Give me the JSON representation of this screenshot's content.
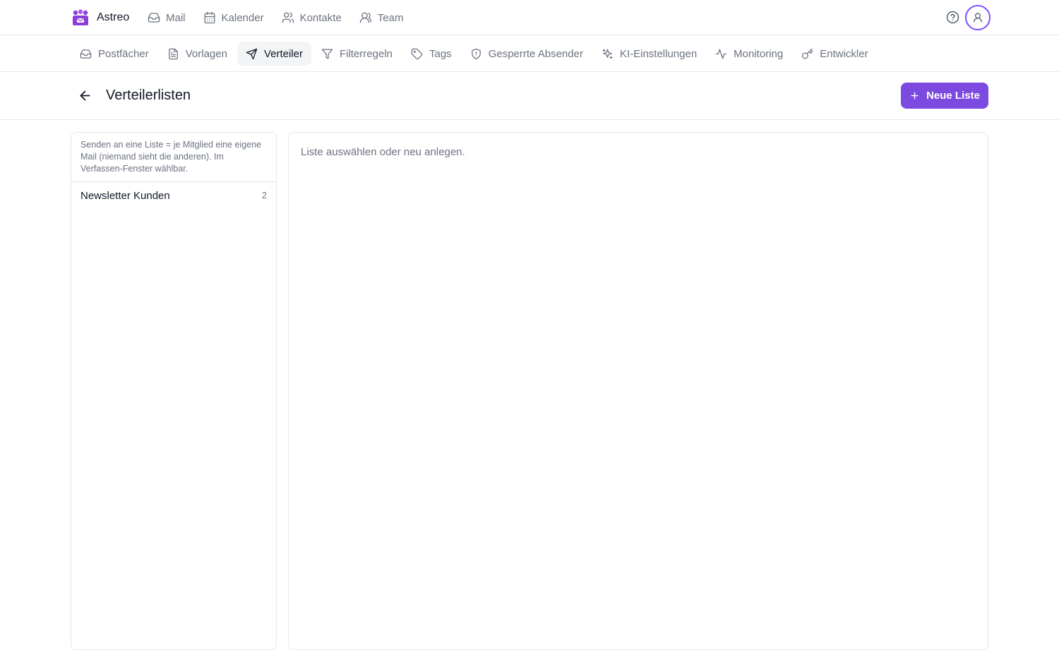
{
  "app": {
    "name": "Astreo",
    "brand_color": "#8b3fd6"
  },
  "topnav": {
    "items": [
      {
        "label": "Mail",
        "icon": "inbox-icon"
      },
      {
        "label": "Kalender",
        "icon": "calendar-icon"
      },
      {
        "label": "Kontakte",
        "icon": "users-icon"
      },
      {
        "label": "Team",
        "icon": "user-group-icon"
      }
    ],
    "help_icon": "help-circle-icon",
    "avatar_icon": "user-icon"
  },
  "subnav": {
    "items": [
      {
        "label": "Postfächer",
        "icon": "inbox-icon",
        "active": false
      },
      {
        "label": "Vorlagen",
        "icon": "file-text-icon",
        "active": false
      },
      {
        "label": "Verteiler",
        "icon": "send-icon",
        "active": true
      },
      {
        "label": "Filterregeln",
        "icon": "filter-icon",
        "active": false
      },
      {
        "label": "Tags",
        "icon": "tag-icon",
        "active": false
      },
      {
        "label": "Gesperrte Absender",
        "icon": "shield-icon",
        "active": false
      },
      {
        "label": "KI-Einstellungen",
        "icon": "sparkles-icon",
        "active": false
      },
      {
        "label": "Monitoring",
        "icon": "activity-icon",
        "active": false
      },
      {
        "label": "Entwickler",
        "icon": "key-icon",
        "active": false
      }
    ]
  },
  "page": {
    "title": "Verteilerlisten",
    "new_button_label": "Neue Liste",
    "accent_color": "#7c4ae0"
  },
  "lists": {
    "hint": "Senden an eine Liste = je Mitglied eine eigene Mail (niemand sieht die anderen). Im Verfassen-Fenster wählbar.",
    "items": [
      {
        "name": "Newsletter Kunden",
        "count": "2"
      }
    ]
  },
  "detail": {
    "empty_text": "Liste auswählen oder neu anlegen."
  }
}
